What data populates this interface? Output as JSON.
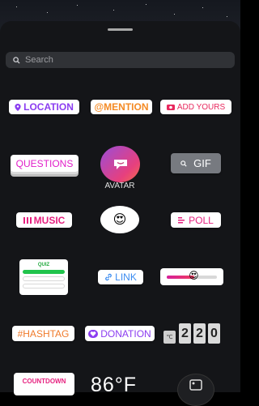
{
  "search": {
    "placeholder": "Search"
  },
  "stickers": {
    "location": "LOCATION",
    "mention": "@MENTION",
    "add_yours": "ADD YOURS",
    "questions": "QUESTIONS",
    "avatar": "AVATAR",
    "gif": "GIF",
    "music": "MUSIC",
    "poll": "POLL",
    "quiz": "QUIZ",
    "link": "LINK",
    "hashtag": "#HASHTAG",
    "donation": "DONATION",
    "temperature_digits": [
      "2",
      "2",
      "0"
    ],
    "countdown": "COUNTDOWN",
    "weather": "86°F"
  },
  "emoji": {
    "reaction": "😍",
    "slider_knob": "😍"
  },
  "slider_level_percent": 55,
  "colors": {
    "sheet": "#141518",
    "location": "#8b3cf0",
    "mention": "#f48a24",
    "add_yours": "#e8285e",
    "questions": "#e11fc9",
    "music": "#e6217f",
    "link": "#3a8bf0",
    "quiz": "#1fa83c"
  },
  "icons": [
    "search-icon",
    "location-pin-icon",
    "camera-icon",
    "music-bars-icon",
    "poll-lines-icon",
    "link-icon",
    "heart-donation-icon",
    "gif-search-icon",
    "avatar-face-icon",
    "photo-icon"
  ]
}
